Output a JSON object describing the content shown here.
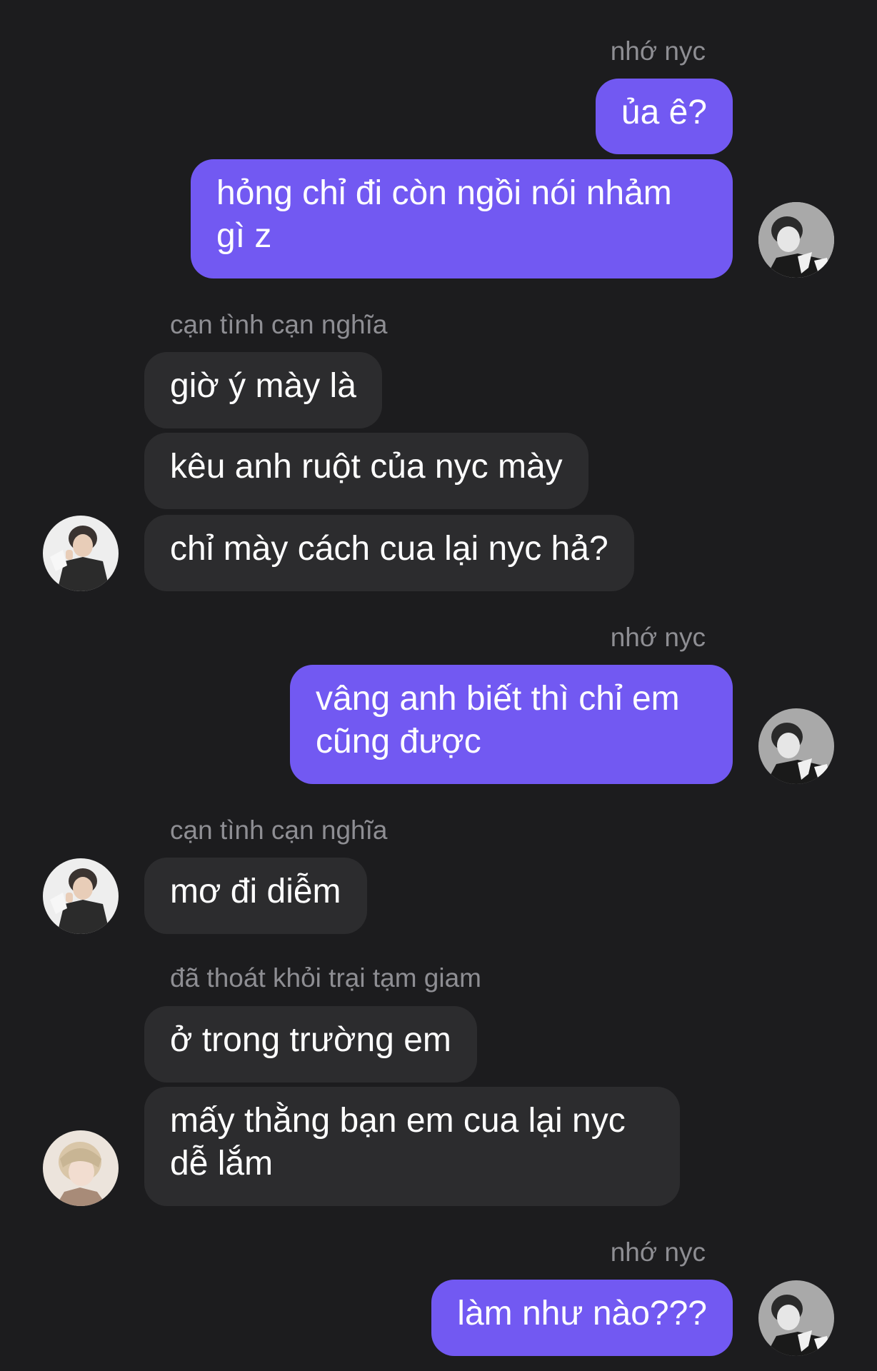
{
  "colors": {
    "background": "#1c1c1e",
    "incoming_bubble": "#2c2c2e",
    "outgoing_bubble": "#7259f2",
    "sender_name": "#8e8e93",
    "text": "#ffffff"
  },
  "messages": {
    "m1_sender": "nhớ nyc",
    "m1_text": "ủa ê?",
    "m2_text": "hỏng chỉ đi còn ngồi nói nhảm gì z",
    "m3_sender": "cạn tình cạn nghĩa",
    "m3_text": "giờ ý mày là",
    "m4_text": "kêu anh ruột của nyc mày",
    "m5_text": "chỉ mày cách cua lại nyc hả?",
    "m6_sender": "nhớ nyc",
    "m6_text": "vâng anh biết thì chỉ em cũng được",
    "m7_sender": "cạn tình cạn nghĩa",
    "m7_text": "mơ đi diễm",
    "m8_sender": "đã thoát khỏi trại tạm giam",
    "m8_text": "ở trong trường em",
    "m9_text": "mấy thằng bạn em cua lại nyc dễ lắm",
    "m10_sender": "nhớ nyc",
    "m10_text": "làm như nào???"
  },
  "avatars": {
    "self": "profile-photo-dark-hair",
    "friend_1": "profile-photo-white-shirt",
    "friend_2": "profile-photo-blonde-hair"
  }
}
